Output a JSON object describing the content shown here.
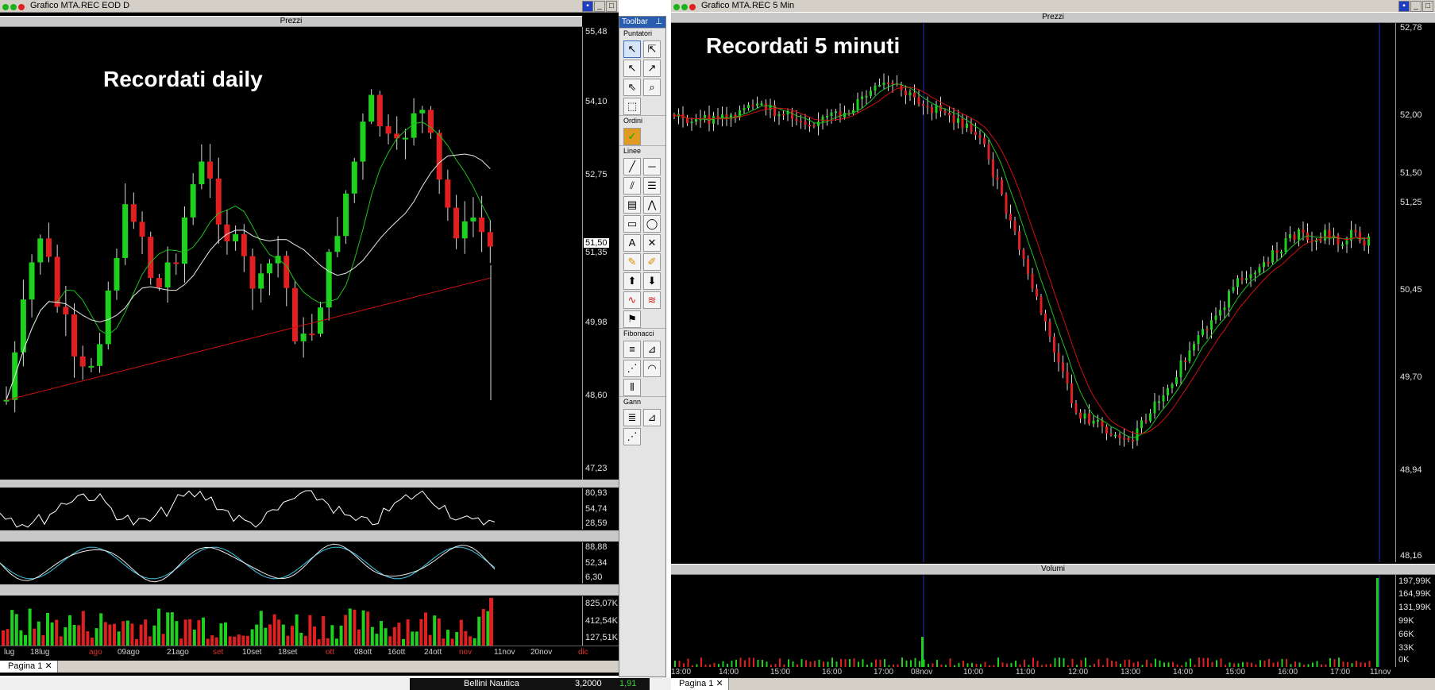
{
  "left_window": {
    "title": "Grafico MTA.REC EOD D",
    "overlay_title": "Recordati daily",
    "price_pane_label": "Prezzi",
    "y_ticks": [
      "55,48",
      "54,10",
      "52,75",
      "51,50",
      "51,35",
      "49,98",
      "48,60",
      "47,23"
    ],
    "price_badge": "51,50",
    "rsi_ticks": [
      "80,93",
      "54,74",
      "28,59"
    ],
    "stoch_ticks": [
      "88,88",
      "52,34",
      "6,30"
    ],
    "vol_ticks": [
      "825,07K",
      "412,54K",
      "127,51K"
    ],
    "x_ticks": [
      "lug",
      "18lug",
      "ago",
      "09ago",
      "21ago",
      "set",
      "10set",
      "18set",
      "ott",
      "08ott",
      "16ott",
      "24ott",
      "nov",
      "11nov",
      "20nov",
      "dic"
    ],
    "tab": "Pagina 1",
    "colors": {
      "up": "#1ed11e",
      "down": "#e02020",
      "sma_green": "#1ec01e",
      "sma_white": "#e8e8e8",
      "sma_red": "#d01010"
    }
  },
  "toolbar": {
    "title": "Toolbar",
    "sections": [
      "Puntatori",
      "Ordini",
      "Linee",
      "Fibonacci",
      "Gann"
    ],
    "icons": {
      "puntatori": [
        "pointer-icon",
        "crosshair-pointer-icon",
        "arrow-icon",
        "arrow-select-icon",
        "arrow-drag-icon",
        "zoom-icon",
        "rectangle-select-icon"
      ],
      "ordini": [
        "order-icon"
      ],
      "linee": [
        "trendline-icon",
        "horizontal-line-icon",
        "parallel-lines-icon",
        "channel-icon",
        "support-resistance-icon",
        "polyline-icon",
        "rectangle-icon",
        "ellipse-icon",
        "text-icon",
        "cross-delete-icon",
        "pencil-icon",
        "pencil-eraser-icon",
        "arrow-up-icon",
        "arrow-down-icon",
        "wave-icon",
        "wave-delete-icon",
        "flag-icon"
      ],
      "fibonacci": [
        "fibo-retracement-icon",
        "fibo-time-icon",
        "fibo-fan-icon",
        "fibo-arc-icon",
        "fibo-time-zones-icon"
      ],
      "gann": [
        "gann-grid-icon",
        "gann-box-icon",
        "gann-fan-icon"
      ]
    }
  },
  "right_window": {
    "title": "Grafico MTA.REC 5 Min",
    "overlay_title": "Recordati 5 minuti",
    "price_pane_label": "Prezzi",
    "volume_pane_label": "Volumi",
    "y_ticks": [
      "52,78",
      "52,00",
      "51,50",
      "51,25",
      "50,45",
      "49,70",
      "48,94",
      "48,16"
    ],
    "price_badge": "51,50",
    "vol_ticks": [
      "197,99K",
      "164,99K",
      "131,99K",
      "99K",
      "66K",
      "33K",
      "0K"
    ],
    "x_ticks": [
      "13:00",
      "14:00",
      "15:00",
      "16:00",
      "17:00",
      "08nov",
      "10:00",
      "11:00",
      "12:00",
      "13:00",
      "14:00",
      "15:00",
      "16:00",
      "17:00",
      "11nov"
    ],
    "tab": "Pagina 1"
  },
  "status_bar": {
    "name": "Bellini Nautica",
    "price": "3,2000",
    "change": "1,91"
  }
}
